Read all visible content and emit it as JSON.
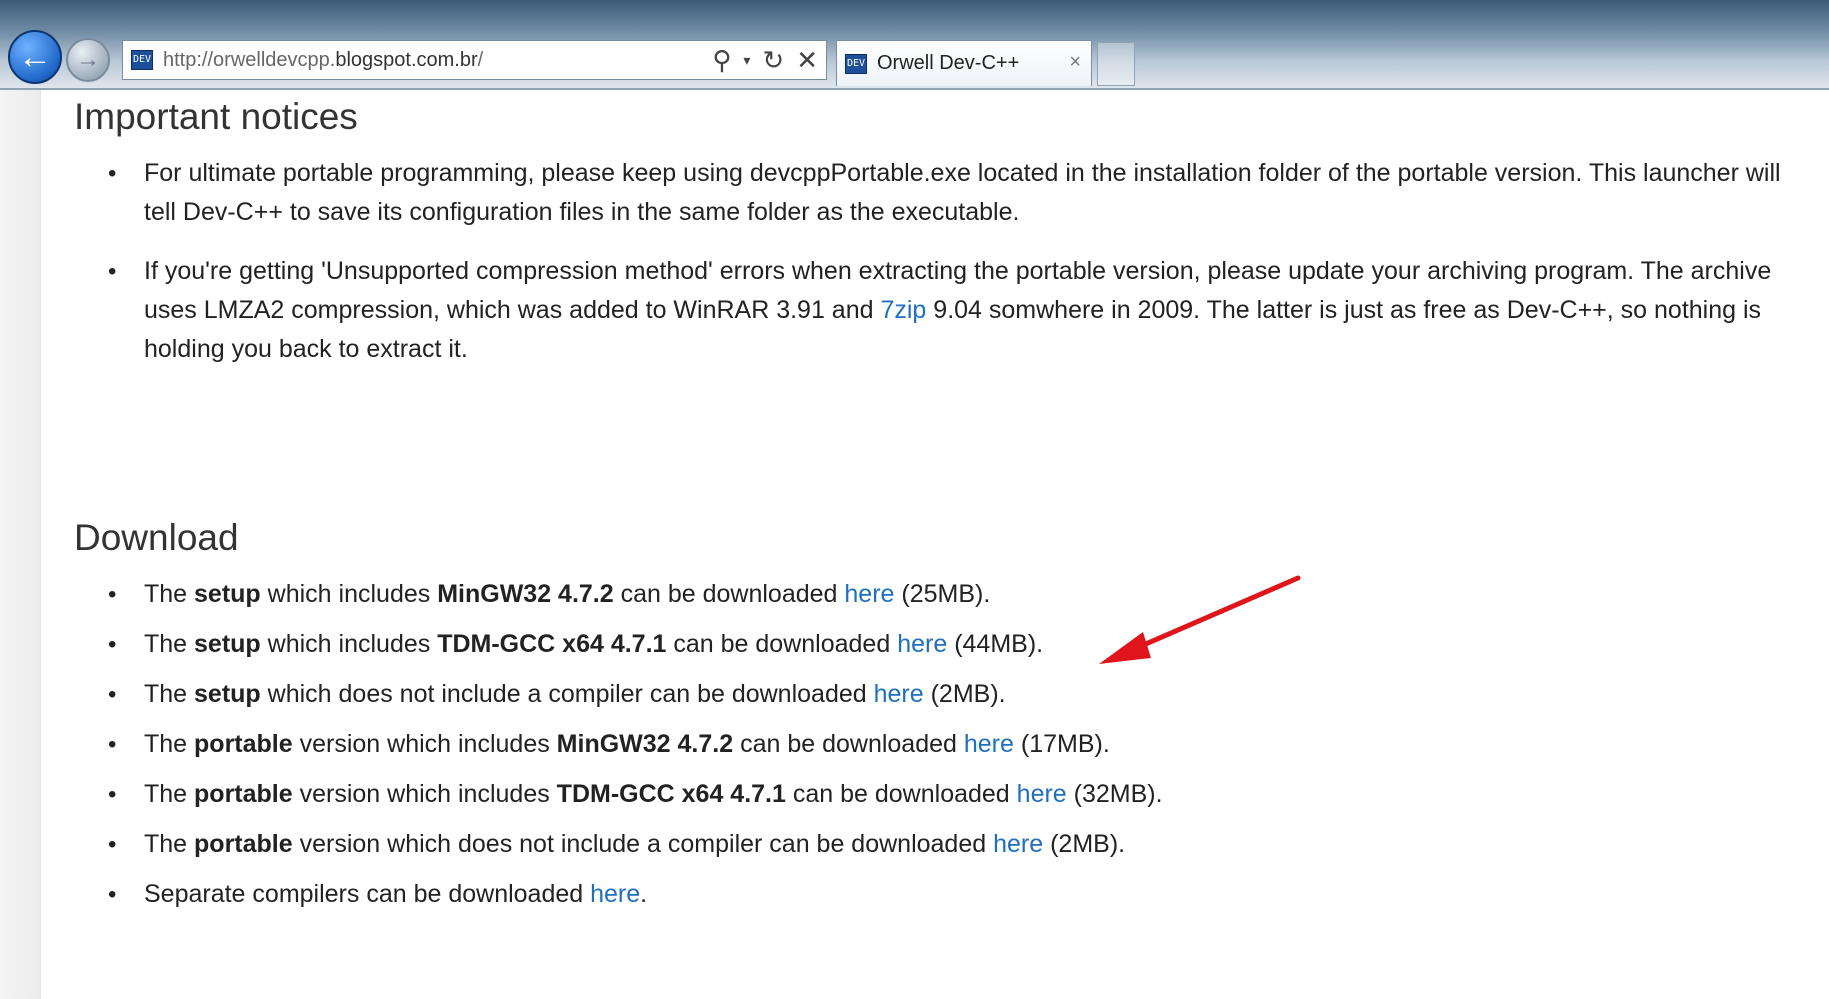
{
  "browser": {
    "address_url_scheme": "http://orwelldevcpp.",
    "address_url_host": "blogspot.com.br",
    "address_url_path": "/",
    "favicon_text": "DEV",
    "tab_title": "Orwell Dev-C++",
    "tab_close": "×",
    "icons": [
      "back-icon",
      "forward-icon",
      "search-icon",
      "dropdown-icon",
      "refresh-icon",
      "stop-icon",
      "close-icon"
    ]
  },
  "notices": {
    "heading": "Important notices",
    "item1": "For ultimate portable programming, please keep using devcppPortable.exe located in the installation folder of the portable version. This launcher will tell Dev-C++ to save its configuration files in the same folder as the executable.",
    "item2_a": "If you're getting 'Unsupported compression method' errors when extracting the portable version, please update your archiving program. The archive uses LMZA2 compression, which was added to WinRAR 3.91 and ",
    "item2_link": "7zip",
    "item2_b": " 9.04 somwhere in 2009. The latter is just as free as Dev-C++, so nothing is holding you back to extract it."
  },
  "download": {
    "heading": "Download",
    "items": [
      {
        "pre": "The ",
        "b1": "setup",
        "mid": " which includes ",
        "b2": "MinGW32 4.7.2",
        "post": " can be downloaded ",
        "link": "here",
        "size": " (25MB)."
      },
      {
        "pre": "The ",
        "b1": "setup",
        "mid": " which includes ",
        "b2": "TDM-GCC x64 4.7.1",
        "post": " can be downloaded ",
        "link": "here",
        "size": " (44MB)."
      },
      {
        "pre": "The ",
        "b1": "setup",
        "mid": " which does not include a compiler can be downloaded ",
        "link": "here",
        "size": " (2MB)."
      },
      {
        "pre": "The ",
        "b1": "portable",
        "mid": " version which includes ",
        "b2": "MinGW32 4.7.2",
        "post": " can be downloaded ",
        "link": "here",
        "size": " (17MB)."
      },
      {
        "pre": "The ",
        "b1": "portable",
        "mid": " version which includes ",
        "b2": "TDM-GCC x64 4.7.1",
        "post": " can be downloaded ",
        "link": "here",
        "size": " (32MB)."
      },
      {
        "pre": "The ",
        "b1": "portable",
        "mid": " version which does not include a compiler can be downloaded ",
        "link": "here",
        "size": " (2MB)."
      },
      {
        "pre": "Separate compilers can be downloaded ",
        "link": "here",
        "size": "."
      }
    ]
  },
  "colors": {
    "link": "#1f6fbf",
    "annotation_arrow": "#e0141b",
    "accent_button": "#1f67c9"
  }
}
